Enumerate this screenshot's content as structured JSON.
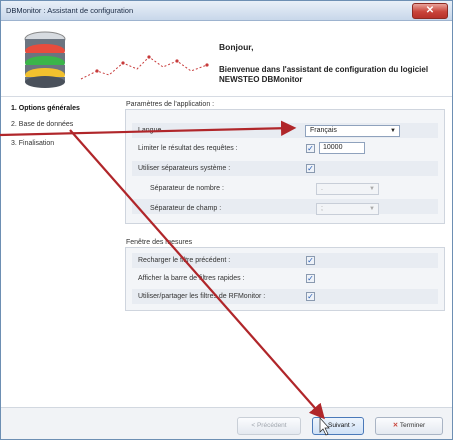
{
  "window": {
    "title": "DBMonitor : Assistant de configuration",
    "close_glyph": "✕"
  },
  "header": {
    "greeting": "Bonjour,",
    "welcome": "Bienvenue dans l'assistant de configuration du logiciel NEWSTEO DBMonitor"
  },
  "steps": [
    {
      "label": "1.  Options générales",
      "active": true
    },
    {
      "label": "2.  Base de données",
      "active": false
    },
    {
      "label": "3.  Finalisation",
      "active": false
    }
  ],
  "app_params": {
    "title": "Paramètres de l'application :",
    "langue_label": "Langue",
    "langue_value": "Français",
    "limit_label": "Limiter le résultat des requêtes :",
    "limit_checked": true,
    "limit_value": "10000",
    "separators_label": "Utiliser séparateurs système :",
    "separators_checked": true,
    "number_sep_label": "Séparateur de nombre :",
    "number_sep_value": ".",
    "field_sep_label": "Séparateur de champ :",
    "field_sep_value": ";"
  },
  "measures": {
    "title": "Fenêtre des mesures",
    "reload_label": "Recharger le filtre précédent :",
    "reload_checked": true,
    "quickbar_label": "Afficher la barre de filtres rapides :",
    "quickbar_checked": true,
    "share_label": "Utiliser/partager les filtres de RFMonitor :",
    "share_checked": true
  },
  "footer": {
    "prev_label": "<  Précédent",
    "next_label": "Suivant  >",
    "finish_label": "Terminer"
  },
  "icons": {
    "prev": "arrow-left-icon",
    "next": "arrow-right-icon",
    "finish": "close-x-icon",
    "logo": "database-icon",
    "cursor": "mouse-cursor-icon"
  },
  "colors": {
    "annotation_arrow": "#b0262a",
    "title_close": "#c9443a",
    "accent": "#2b5fb4"
  }
}
